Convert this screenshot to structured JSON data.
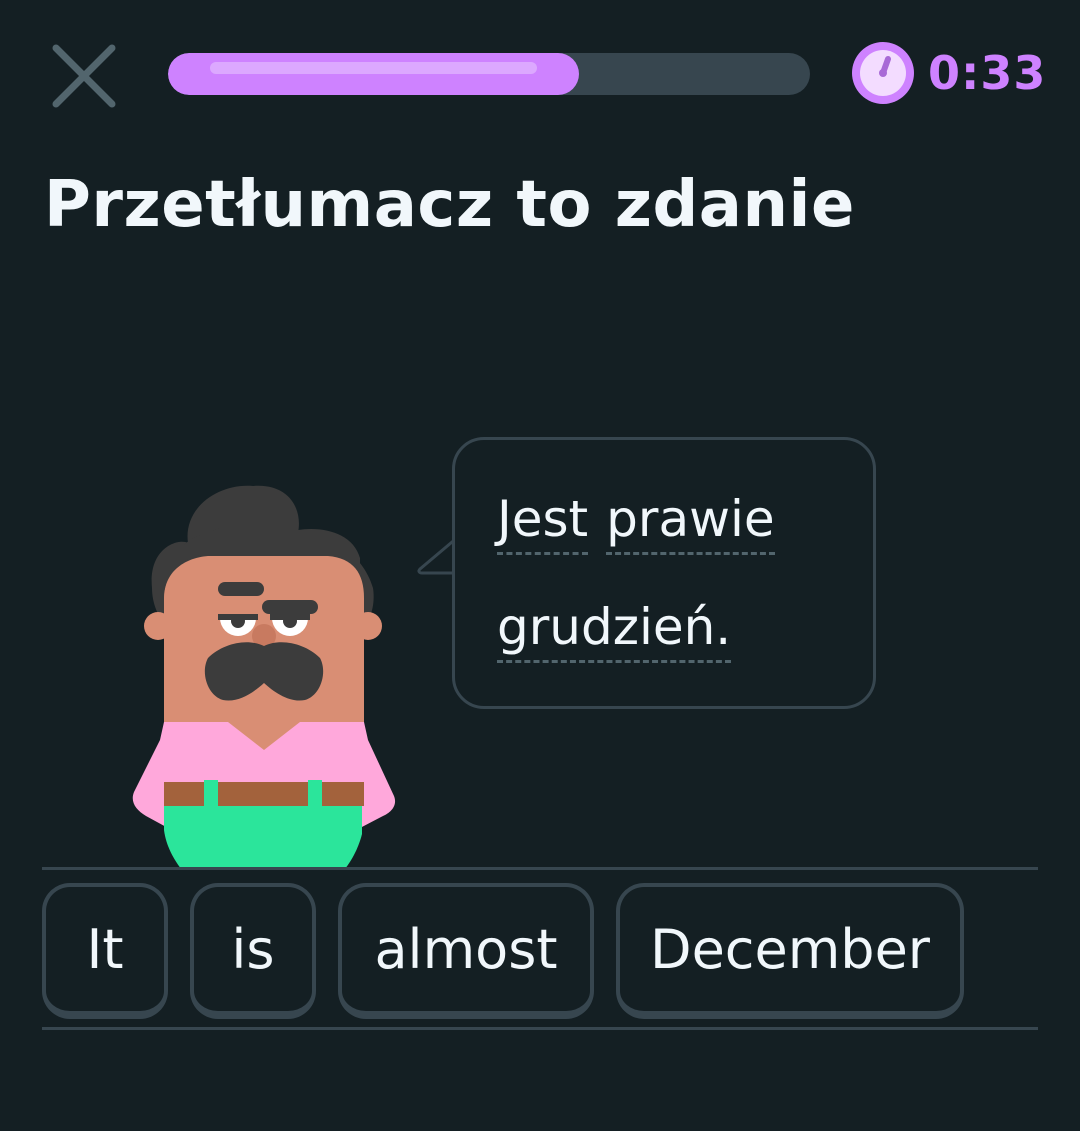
{
  "header": {
    "close_icon": "close-icon",
    "progress": 0.64,
    "timer_icon": "timer-icon",
    "timer_text": "0:33",
    "accent_color": "#ce82ff"
  },
  "title": "Przetłumacz to zdanie",
  "bubble": {
    "lines": [
      [
        "Jest",
        "prawie"
      ],
      [
        "grudzień."
      ]
    ]
  },
  "answer_tiles": [
    "It",
    "is",
    "almost",
    "December"
  ],
  "colors": {
    "background": "#141f23",
    "border": "#37464f",
    "text": "#f1f7fb"
  }
}
